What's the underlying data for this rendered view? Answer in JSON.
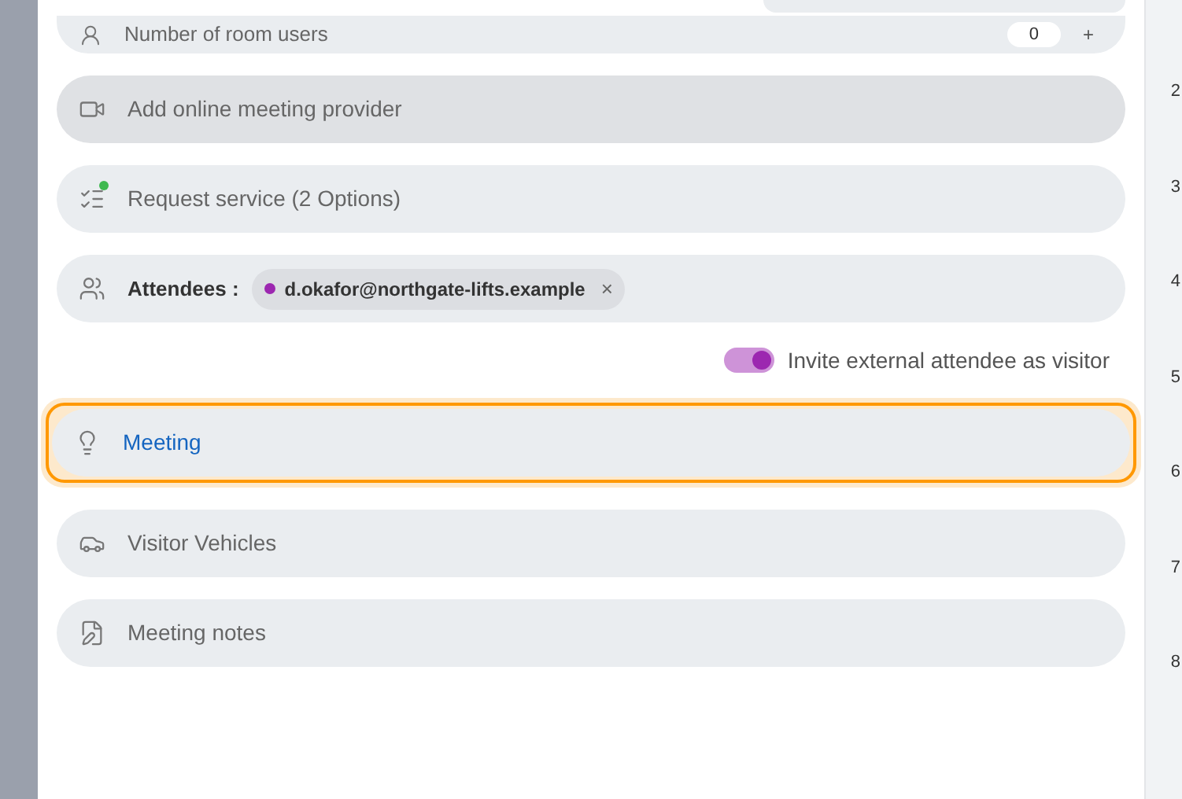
{
  "room_users": {
    "label": "Number of room users",
    "value": "0",
    "increment": "+"
  },
  "rows": [
    {
      "kind": "video",
      "label": "Add online meeting provider",
      "highlighted": true,
      "selected": false
    },
    {
      "kind": "service",
      "label": "Request service (2 Options)",
      "highlighted": false,
      "selected": false,
      "badge": true
    },
    {
      "kind": "attendees",
      "label": "Attendees :",
      "highlighted": false,
      "selected": false,
      "chips": [
        {
          "text": "d.okafor@northgate-lifts.example",
          "color": "#9c27b0",
          "remove": "×"
        }
      ]
    },
    {
      "kind": "toggle",
      "label": "Invite external attendee as visitor",
      "on": true
    },
    {
      "kind": "subject",
      "label": "Meeting",
      "highlighted": false,
      "selected": true
    },
    {
      "kind": "car",
      "label": "Visitor Vehicles",
      "highlighted": false,
      "selected": false
    },
    {
      "kind": "notes",
      "label": "Meeting notes",
      "highlighted": false,
      "selected": false
    }
  ],
  "hour_labels": [
    "2",
    "3",
    "4",
    "5",
    "6",
    "7",
    "8"
  ]
}
